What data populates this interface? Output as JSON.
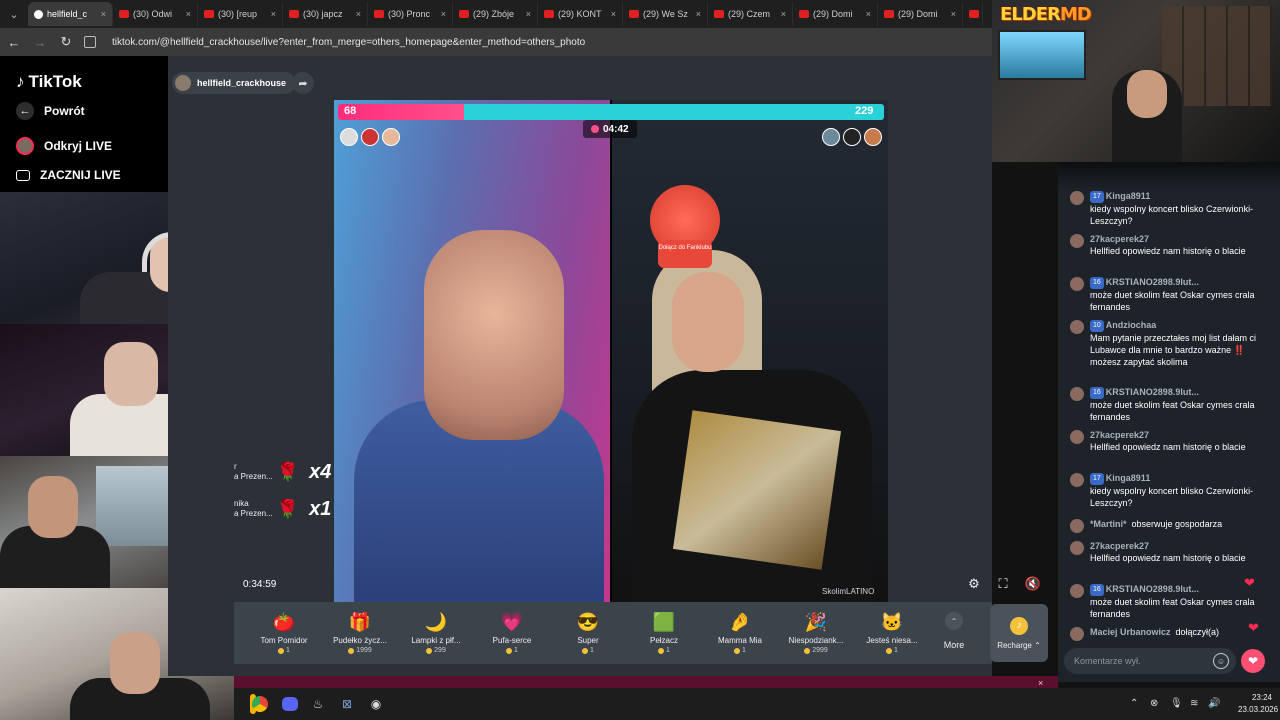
{
  "browser": {
    "tabs": [
      {
        "label": "hellfield_c",
        "active": true
      },
      {
        "label": "(30) Odwi",
        "active": false
      },
      {
        "label": "(30) [reup",
        "active": false
      },
      {
        "label": "(30) japcz",
        "active": false
      },
      {
        "label": "(30) Pronc",
        "active": false
      },
      {
        "label": "(29) Zbóje",
        "active": false
      },
      {
        "label": "(29) KONT",
        "active": false
      },
      {
        "label": "(29) We Sz",
        "active": false
      },
      {
        "label": "(29) Czem",
        "active": false
      },
      {
        "label": "(29) Domi",
        "active": false
      },
      {
        "label": "(29) Domi",
        "active": false
      },
      {
        "label": "Je",
        "active": false
      }
    ],
    "tab_close": "×",
    "url": "tiktok.com/@hellfield_crackhouse/live?enter_from_merge=others_homepage&enter_method=others_photo"
  },
  "overlay": {
    "logo_text": "ELDER..."
  },
  "sidebar": {
    "brand": "TikTok",
    "back_label": "Powrót",
    "discover_label": "Odkryj LIVE",
    "start_label": "ZACZNIJ LIVE"
  },
  "live": {
    "host_name": "hellfield_crackhouse",
    "battle": {
      "left_score": "68",
      "right_score": "229",
      "left_fraction": 0.23,
      "timer": "04:42",
      "crown_label": "Dołącz do Fanklubu",
      "watermark": "SkolimLATINO"
    },
    "elapsed": "0:34:59",
    "gift_notifications": [
      {
        "name": "a Prezen...",
        "prefix": "r",
        "multiplier": "x4"
      },
      {
        "name": "a Prezen...",
        "prefix": "nika",
        "multiplier": "x1"
      }
    ]
  },
  "gifts": [
    {
      "name": "Tom Pomidor",
      "price": "1",
      "icon": "tomato-gift-icon",
      "glyph": "🍅"
    },
    {
      "name": "Pudełko życz...",
      "price": "1999",
      "icon": "chest-gift-icon",
      "glyph": "🎁"
    },
    {
      "name": "Lampki z płf...",
      "price": "299",
      "icon": "moon-lamp-gift-icon",
      "glyph": "🌙"
    },
    {
      "name": "Pufa-serce",
      "price": "1",
      "icon": "heart-pouf-gift-icon",
      "glyph": "💗"
    },
    {
      "name": "Super",
      "price": "1",
      "icon": "sunglasses-gift-icon",
      "glyph": "😎"
    },
    {
      "name": "Pełzacz",
      "price": "1",
      "icon": "creeper-gift-icon",
      "glyph": "🟩"
    },
    {
      "name": "Mamma Mia",
      "price": "1",
      "icon": "hand-gift-icon",
      "glyph": "🤌"
    },
    {
      "name": "Niespodziank...",
      "price": "2999",
      "icon": "surprise-gift-icon",
      "glyph": "🎉"
    },
    {
      "name": "Jesteś niesa...",
      "price": "1",
      "icon": "cat-gift-icon",
      "glyph": "🐱"
    }
  ],
  "more_label": "More",
  "recharge_label": "Recharge ⌃",
  "chat": {
    "messages": [
      {
        "user": "Kinga8911",
        "level": "17",
        "text": "kiedy wspolny koncert blisko Czerwionki-Leszczyn?"
      },
      {
        "user": "27kacperek27",
        "level": "",
        "text": "Hellfied opowiedz nam historię o blacie"
      },
      {
        "user": "KRSTIANO2898.9lut...",
        "level": "16",
        "text": "może duet skolim feat Oskar cymes crala fernandes"
      },
      {
        "user": "Andziochaa",
        "level": "10",
        "text": "Mam pytanie przecztałes moj list dałam ci Lubawce dla mnie to bardzo ważne ‼️ możesz zapytać skolima"
      },
      {
        "user": "KRSTIANO2898.9lut...",
        "level": "16",
        "text": "może duet skolim feat Oskar cymes crala fernandes"
      },
      {
        "user": "27kacperek27",
        "level": "",
        "text": "Hellfied opowiedz nam historię o blacie"
      },
      {
        "user": "Kinga8911",
        "level": "17",
        "text": "kiedy wspolny koncert blisko Czerwionki-Leszczyn?"
      },
      {
        "user": "*Martini*",
        "level": "",
        "text": "obserwuje gospodarza"
      },
      {
        "user": "27kacperek27",
        "level": "",
        "text": "Hellfied opowiedz nam historię o blacie"
      },
      {
        "user": "KRSTIANO2898.9lut...",
        "level": "16",
        "text": "może duet skolim feat Oskar cymes crala fernandes"
      },
      {
        "user": "Maciej Urbanowicz",
        "level": "",
        "text": "dołączył(a)"
      }
    ],
    "input_placeholder": "Komentarze wył."
  },
  "taskbar": {
    "time": "23:24",
    "date": "23.03.2026"
  }
}
